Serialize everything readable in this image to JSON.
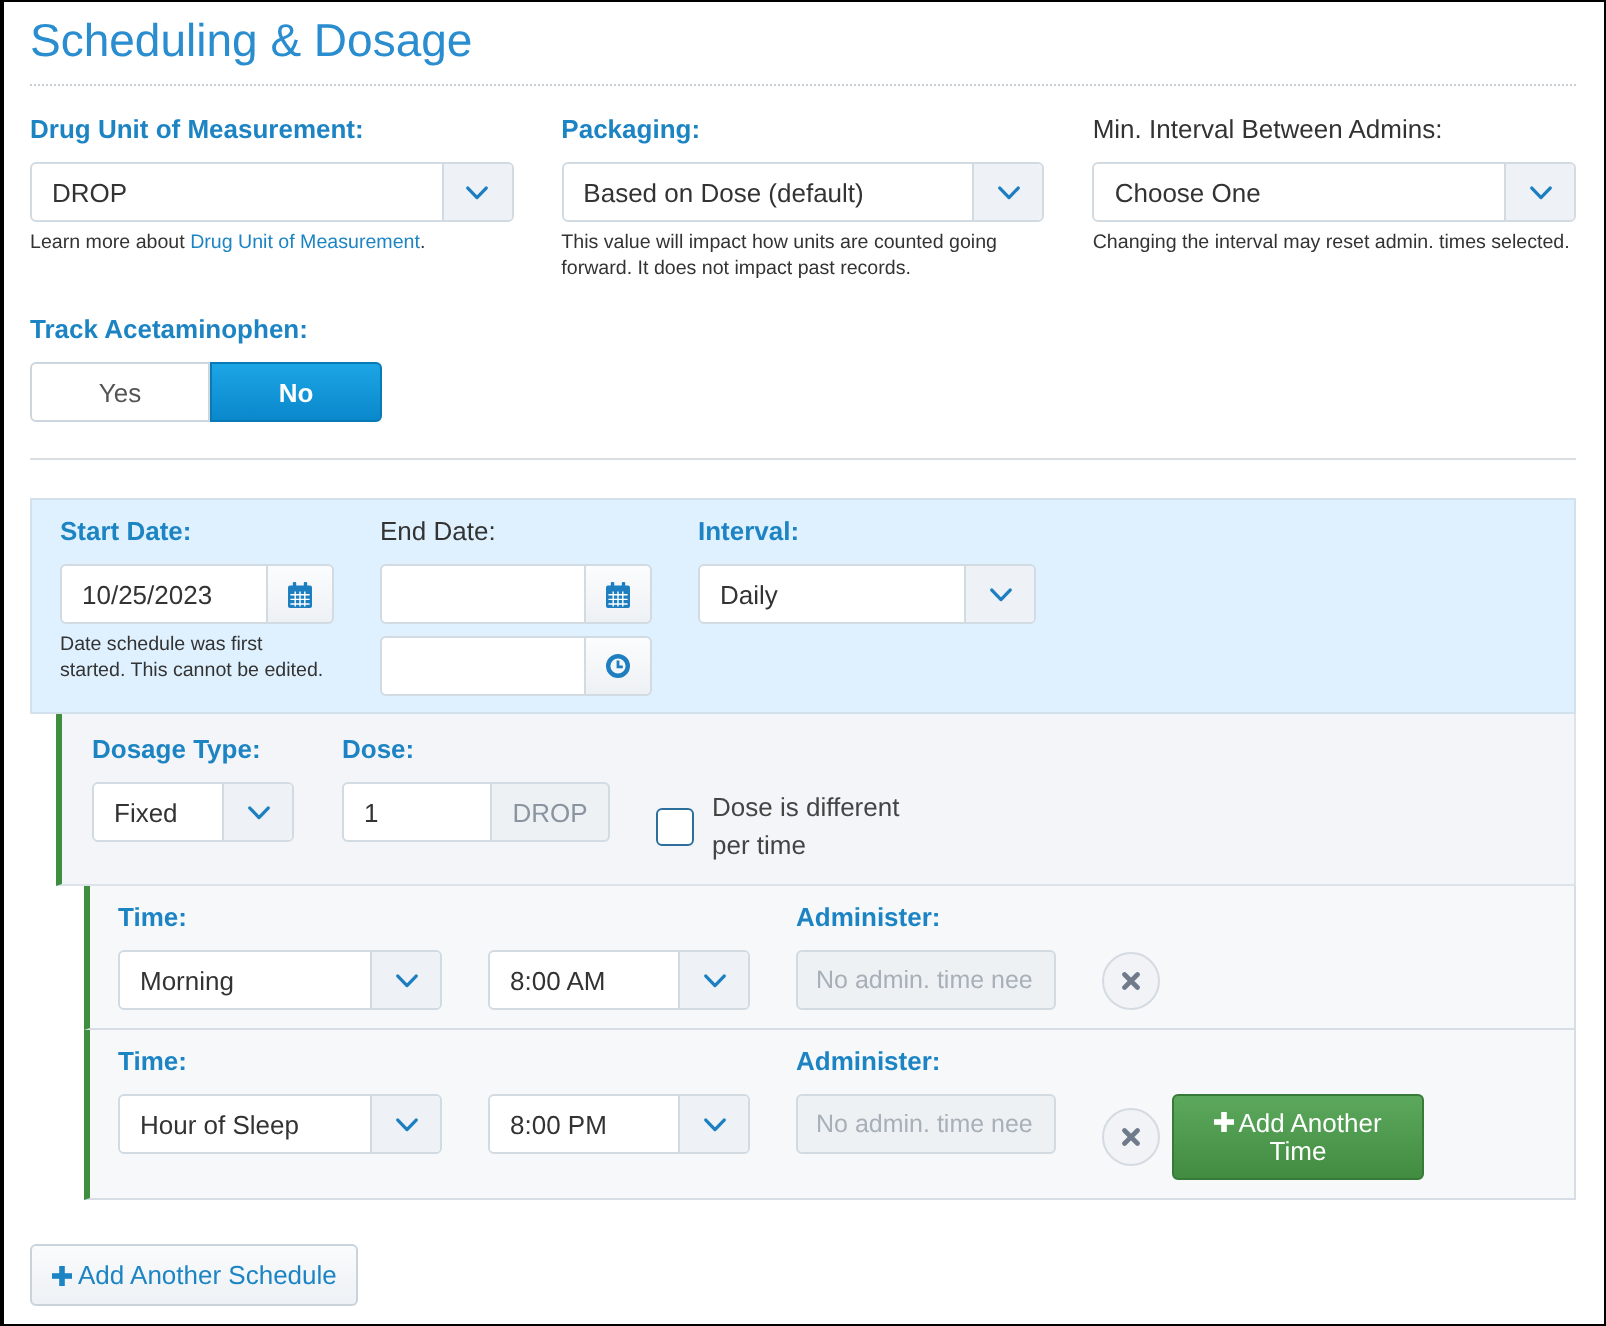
{
  "header": {
    "title": "Scheduling & Dosage"
  },
  "settings": [
    {
      "label": "Drug Unit of Measurement:",
      "emphasized": true,
      "value": "DROP",
      "help": "Learn more about ",
      "help_link": "Drug Unit of Measurement",
      "help_end": "."
    },
    {
      "label": "Packaging:",
      "emphasized": true,
      "value": "Based on Dose (default)",
      "help": "This value will impact how units are counted going forward. It does not impact past records."
    },
    {
      "label": "Min. Interval Between Admins:",
      "emphasized": false,
      "value": "Choose One",
      "help": "Changing the interval may reset admin. times selected."
    }
  ],
  "track_acetaminophen": {
    "label": "Track Acetaminophen:",
    "options": [
      {
        "label": "Yes",
        "selected": false
      },
      {
        "label": "No",
        "selected": true
      }
    ]
  },
  "schedule": {
    "fields": [
      {
        "kind": "date",
        "label": "Start Date:",
        "emphasized": true,
        "value": "10/25/2023",
        "help": "Date schedule was first started. This cannot be edited."
      },
      {
        "kind": "date_time",
        "label": "End Date:",
        "emphasized": false
      },
      {
        "kind": "select",
        "label": "Interval:",
        "emphasized": true,
        "value": "Daily"
      }
    ],
    "dosage": {
      "type_label": "Dosage Type:",
      "type_value": "Fixed",
      "dose_label": "Dose:",
      "dose_value": "1",
      "dose_unit": "DROP",
      "varies_label": "Dose is different per time",
      "varies_checked": false
    },
    "times": [
      {
        "label": "Time:",
        "slot": "Morning",
        "clock": "8:00 AM",
        "administer_label": "Administer:",
        "administer_placeholder": "No admin. time nee",
        "administer_disabled": true
      },
      {
        "label": "Time:",
        "slot": "Hour of Sleep",
        "clock": "8:00 PM",
        "administer_label": "Administer:",
        "administer_placeholder": "No admin. time nee",
        "administer_disabled": true
      }
    ],
    "add_time_button": "Add Another Time"
  },
  "add_schedule_button": "Add Another Schedule"
}
